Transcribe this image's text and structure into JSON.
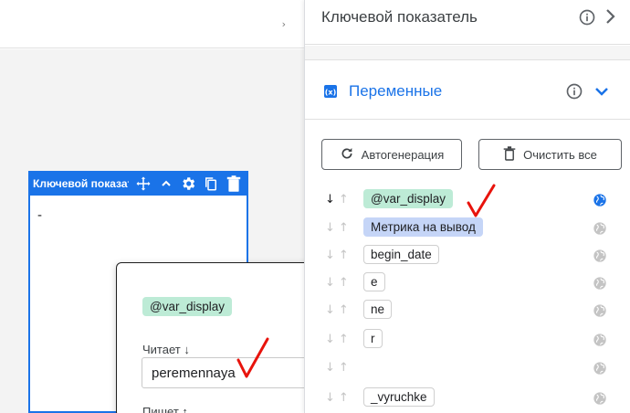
{
  "canvas": {
    "topbar_arrow": "›",
    "widget": {
      "title": "Ключевой показатель",
      "content": "-"
    }
  },
  "popup": {
    "close": "×",
    "variable_chip": "@var_display",
    "reads_label": "Читает ↓",
    "reads_value": "peremennaya",
    "writes_label": "Пишет ↑"
  },
  "panel": {
    "header_title": "Ключевой показатель",
    "section_title": "Переменные",
    "autogen_label": "Автогенерация",
    "clear_label": "Очистить все",
    "variables": [
      {
        "name": "@var_display",
        "style": "green",
        "read_active": true,
        "globe_active": true
      },
      {
        "name": "Метрика на вывод",
        "style": "blue",
        "read_active": false,
        "globe_active": false
      },
      {
        "name": "begin_date",
        "style": "outline",
        "read_active": false,
        "globe_active": false
      },
      {
        "name": "e",
        "style": "outline",
        "read_active": false,
        "globe_active": false
      },
      {
        "name": "ne",
        "style": "outline",
        "read_active": false,
        "globe_active": false
      },
      {
        "name": "r",
        "style": "outline",
        "read_active": false,
        "globe_active": false
      },
      {
        "name": "",
        "style": "none",
        "read_active": false,
        "globe_active": false
      },
      {
        "name": "_vyruchke",
        "style": "outline",
        "read_active": false,
        "globe_active": false
      }
    ]
  },
  "colors": {
    "accent": "#1a73e8",
    "chip_green": "#bdebd6",
    "chip_blue": "#c5d5f7",
    "annotation": "#e8130c"
  }
}
